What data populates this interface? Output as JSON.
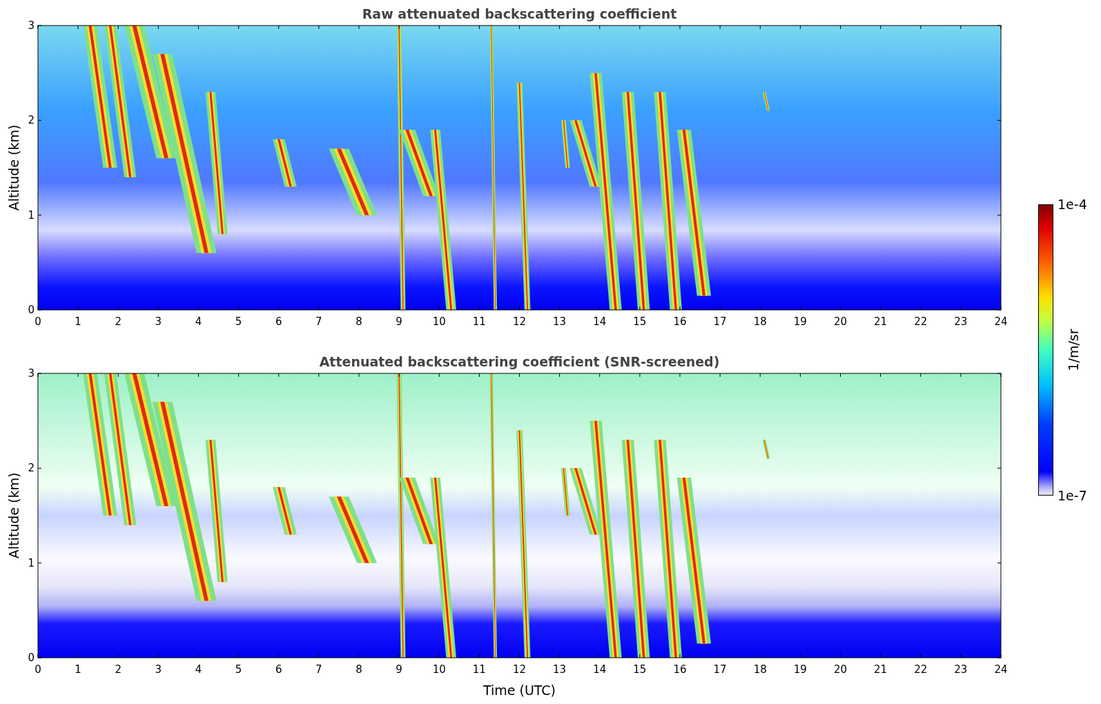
{
  "panels": [
    {
      "kind": "raw",
      "title": "Raw attenuated backscattering coefficient",
      "ylabel": "Altitude (km)",
      "yticks": [
        "3",
        "2",
        "1",
        "0"
      ],
      "xticks": [
        "0",
        "1",
        "2",
        "3",
        "4",
        "5",
        "6",
        "7",
        "8",
        "9",
        "10",
        "11",
        "12",
        "13",
        "14",
        "15",
        "16",
        "17",
        "18",
        "19",
        "20",
        "21",
        "22",
        "23",
        "24"
      ]
    },
    {
      "kind": "screened",
      "title": "Attenuated backscattering coefficient (SNR-screened)",
      "ylabel": "Altitude (km)",
      "yticks": [
        "3",
        "2",
        "1",
        "0"
      ],
      "xticks": [
        "0",
        "1",
        "2",
        "3",
        "4",
        "5",
        "6",
        "7",
        "8",
        "9",
        "10",
        "11",
        "12",
        "13",
        "14",
        "15",
        "16",
        "17",
        "18",
        "19",
        "20",
        "21",
        "22",
        "23",
        "24"
      ]
    }
  ],
  "xlabel": "Time (UTC)",
  "colorbar": {
    "max_label": "1e-4",
    "min_label": "1e-7",
    "label": "1/m/sr"
  }
}
